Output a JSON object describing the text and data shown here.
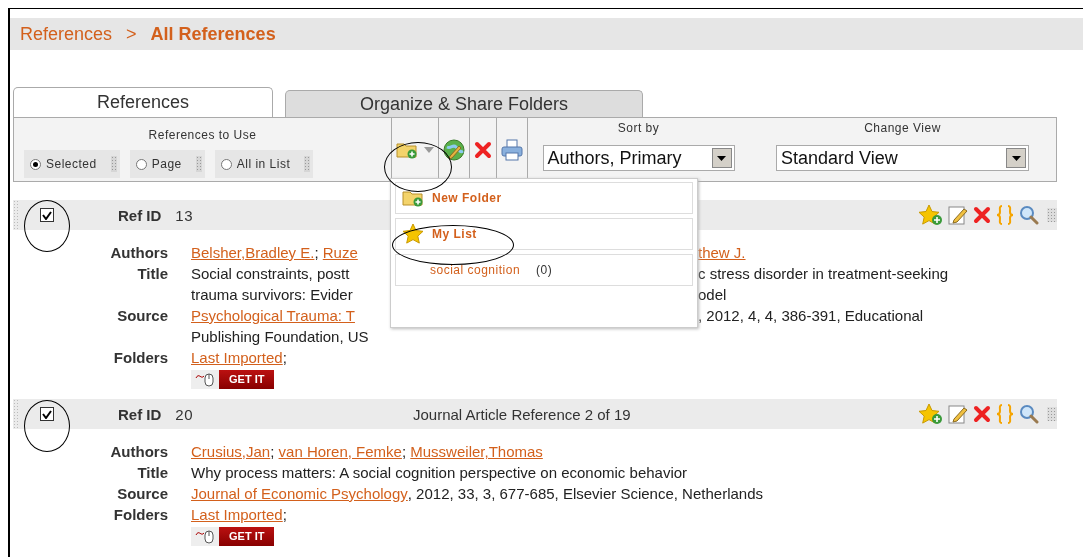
{
  "breadcrumb": {
    "items": [
      {
        "text": "References",
        "current": false
      },
      {
        "text": "All References",
        "current": true
      }
    ],
    "separator": ">"
  },
  "tabs": [
    {
      "label": "References",
      "selected": true
    },
    {
      "label": "Organize & Share Folders",
      "selected": false
    }
  ],
  "toolbar": {
    "scope_label": "References to Use",
    "scope_options": [
      {
        "label": "Selected",
        "selected": true
      },
      {
        "label": "Page",
        "selected": false
      },
      {
        "label": "All in List",
        "selected": false
      }
    ],
    "sort_label": "Sort by",
    "sort_value": "Authors, Primary",
    "view_label": "Change View",
    "view_value": "Standard View"
  },
  "folder_menu": {
    "expanded": true,
    "items": [
      {
        "kind": "new",
        "label": "New Folder"
      },
      {
        "kind": "starred",
        "label": "My List"
      },
      {
        "kind": "folder",
        "label": "social cognition",
        "count": "(0)"
      }
    ]
  },
  "records": [
    {
      "checked": true,
      "ref_label": "Ref ID",
      "ref_id": "13",
      "get_it": "GET IT",
      "fields": [
        {
          "kind": "authors",
          "label": "Authors",
          "lines": [
            {
              "left": [
                {
                  "text": "Belsher,Bradley E.",
                  "link": true
                },
                {
                  "text": ";",
                  "link": false
                },
                {
                  "text": "Ruze",
                  "link": true
                }
              ],
              "right": [
                {
                  "text": "thew J.",
                  "link": true
                }
              ]
            }
          ]
        },
        {
          "kind": "title",
          "label": "Title",
          "lines": [
            {
              "left": [
                {
                  "text": "Social constraints, postt",
                  "link": false
                }
              ],
              "right": [
                {
                  "text": "c stress disorder in treatment-seeking",
                  "link": false
                }
              ]
            },
            {
              "left": [
                {
                  "text": "trauma survivors: Evider",
                  "link": false
                }
              ],
              "right": [
                {
                  "text": "odel",
                  "link": false
                }
              ]
            }
          ]
        },
        {
          "kind": "source",
          "label": "Source",
          "lines": [
            {
              "left": [
                {
                  "text": "Psychological Trauma: T",
                  "link": true
                }
              ],
              "right": [
                {
                  "text": ", 2012, 4, 4, 386-391, Educational",
                  "link": false
                }
              ]
            },
            {
              "left": [
                {
                  "text": "Publishing Foundation, US",
                  "link": false
                }
              ]
            }
          ]
        },
        {
          "kind": "folders",
          "label": "Folders",
          "lines": [
            {
              "left": [
                {
                  "text": "Last Imported",
                  "link": true
                },
                {
                  "text": ";",
                  "link": false
                }
              ]
            }
          ]
        }
      ]
    },
    {
      "checked": true,
      "ref_label": "Ref ID",
      "ref_id": "20",
      "type_text": "Journal Article Reference 2 of 19",
      "get_it": "GET IT",
      "fields": [
        {
          "kind": "authors",
          "label": "Authors",
          "lines": [
            {
              "left": [
                {
                  "text": "Crusius,Jan",
                  "link": true
                },
                {
                  "text": ";",
                  "link": false
                },
                {
                  "text": "van Horen, Femke",
                  "link": true
                },
                {
                  "text": ";",
                  "link": false
                },
                {
                  "text": "Mussweiler,Thomas",
                  "link": true
                }
              ]
            }
          ]
        },
        {
          "kind": "title",
          "label": "Title",
          "lines": [
            {
              "left": [
                {
                  "text": "Why process matters: A social cognition perspective on economic behavior",
                  "link": false
                }
              ]
            }
          ]
        },
        {
          "kind": "source",
          "label": "Source",
          "lines": [
            {
              "left": [
                {
                  "text": "Journal of Economic Psychology",
                  "link": true
                },
                {
                  "text": ", 2012, 33, 3, 677-685, Elsevier Science, Netherlands",
                  "link": false
                }
              ]
            }
          ]
        },
        {
          "kind": "folders",
          "label": "Folders",
          "lines": [
            {
              "left": [
                {
                  "text": "Last Imported",
                  "link": true
                },
                {
                  "text": ";",
                  "link": false
                }
              ]
            }
          ]
        }
      ]
    }
  ]
}
